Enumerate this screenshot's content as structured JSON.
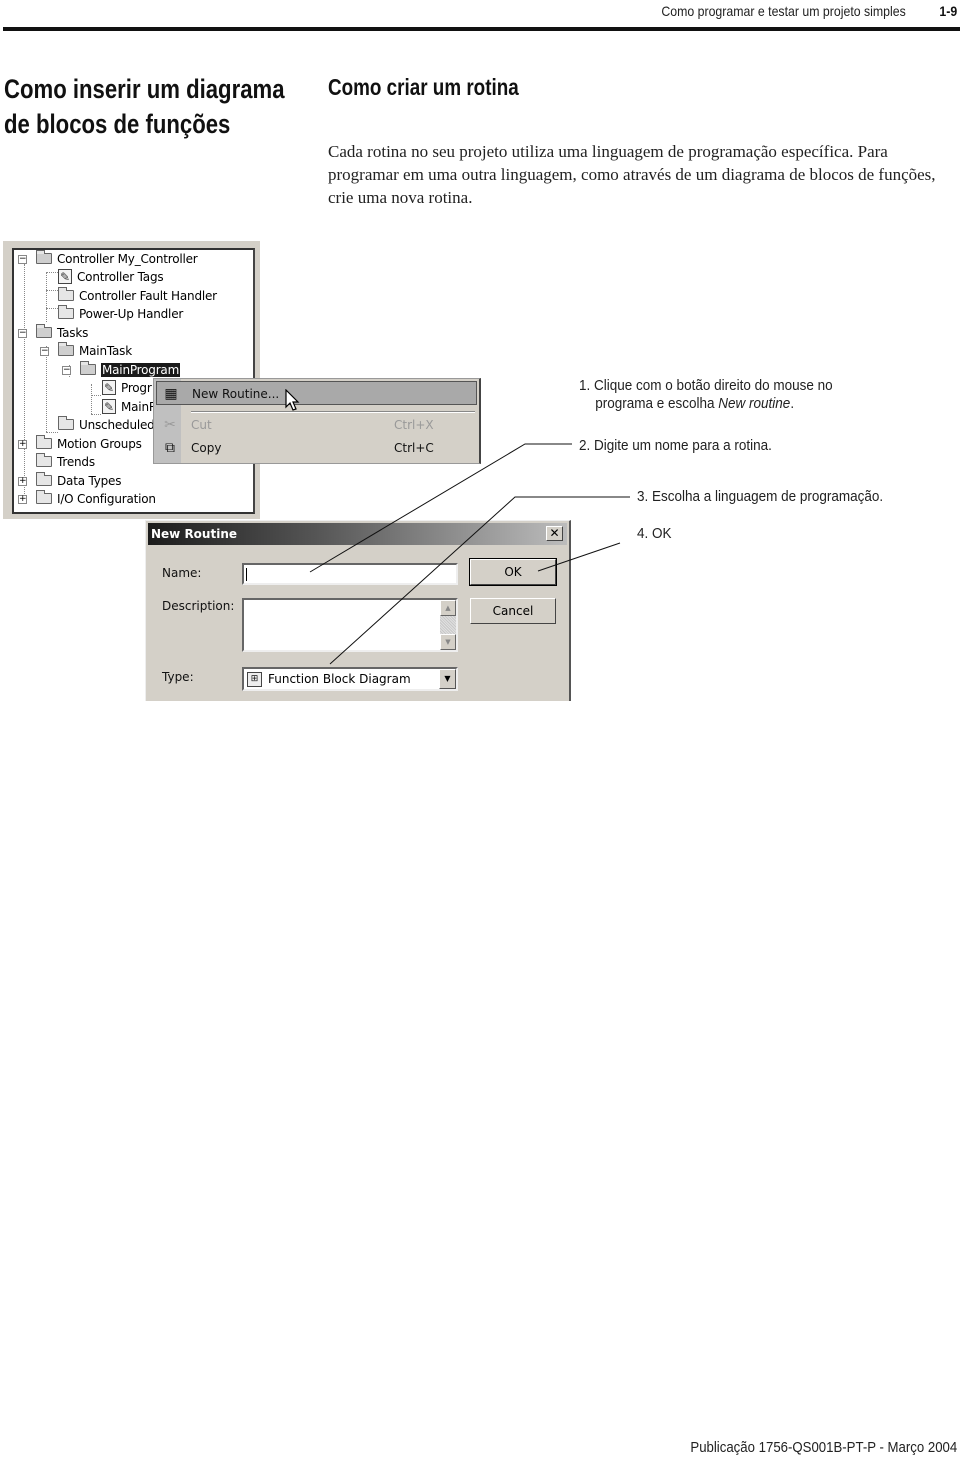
{
  "header": {
    "running_title": "Como programar e testar um projeto simples",
    "page_number": "1-9"
  },
  "side_heading": {
    "line1": "Como inserir um diagrama",
    "line2": "de blocos de funções"
  },
  "section": {
    "heading": "Como criar um rotina",
    "paragraph": "Cada rotina no seu projeto utiliza uma linguagem de programação específica. Para programar em uma outra linguagem, como através de um diagrama de blocos de funções, crie uma nova rotina."
  },
  "tree": {
    "items": [
      {
        "label": "Controller My_Controller",
        "icon": "folder-open-icon",
        "expander": "−"
      },
      {
        "label": "Controller Tags",
        "icon": "tags-icon"
      },
      {
        "label": "Controller Fault Handler",
        "icon": "folder-icon"
      },
      {
        "label": "Power-Up Handler",
        "icon": "folder-icon"
      },
      {
        "label": "Tasks",
        "icon": "folder-open-icon",
        "expander": "−"
      },
      {
        "label": "MainTask",
        "icon": "task-icon",
        "expander": "−"
      },
      {
        "label": "MainProgram",
        "icon": "program-icon",
        "expander": "−",
        "selected": true
      },
      {
        "label": "Progr",
        "icon": "tags-icon"
      },
      {
        "label": "MainR",
        "icon": "routine-icon"
      },
      {
        "label": "Unscheduled",
        "icon": "folder-icon"
      },
      {
        "label": "Motion Groups",
        "icon": "folder-icon",
        "expander": "+"
      },
      {
        "label": "Trends",
        "icon": "folder-icon"
      },
      {
        "label": "Data Types",
        "icon": "folder-icon",
        "expander": "+"
      },
      {
        "label": "I/O Configuration",
        "icon": "folder-icon",
        "expander": "+"
      }
    ]
  },
  "context_menu": {
    "items": [
      {
        "label": "New Routine...",
        "icon": "new-routine-icon",
        "highlighted": true,
        "shortcut": ""
      },
      {
        "label": "Cut",
        "icon": "scissors-icon",
        "disabled": true,
        "shortcut": "Ctrl+X"
      },
      {
        "label": "Copy",
        "icon": "copy-icon",
        "shortcut": "Ctrl+C"
      }
    ]
  },
  "dialog": {
    "title": "New Routine",
    "close_glyph": "✕",
    "name_label": "Name:",
    "name_value": "",
    "description_label": "Description:",
    "description_value": "",
    "type_label": "Type:",
    "type_value": "Function Block Diagram",
    "ok_label": "OK",
    "cancel_label": "Cancel"
  },
  "callouts": [
    {
      "number": "1.",
      "line1": "Clique com o botão direito do mouse no",
      "line2_prefix": "programa e escolha ",
      "line2_italic": "New routine",
      "line2_suffix": "."
    },
    {
      "number": "2.",
      "text": "Digite um nome para a rotina."
    },
    {
      "number": "3.",
      "text": "Escolha a linguagem de programação."
    },
    {
      "number": "4.",
      "text": "OK"
    }
  ],
  "footer": {
    "publication": "Publicação 1756-QS001B-PT-P - Março 2004"
  }
}
